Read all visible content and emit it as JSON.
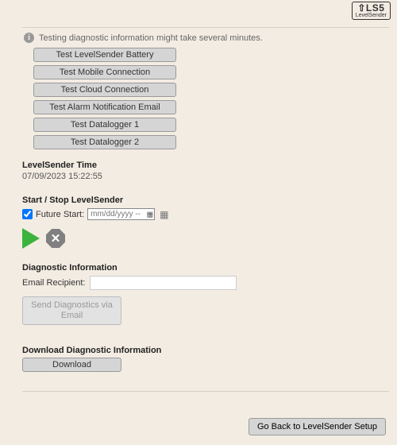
{
  "logo": {
    "top": "⇧LS5",
    "sub": "LevelSender"
  },
  "note": "Testing diagnostic information might take several minutes.",
  "test_buttons": [
    "Test LevelSender Battery",
    "Test Mobile Connection",
    "Test Cloud Connection",
    "Test Alarm Notification Email",
    "Test Datalogger 1",
    "Test Datalogger 2"
  ],
  "time": {
    "title": "LevelSender Time",
    "value": "07/09/2023 15:22:55"
  },
  "startstop": {
    "title": "Start / Stop LevelSender",
    "future_label": "Future Start:",
    "date_placeholder": "mm/dd/yyyy --"
  },
  "diag": {
    "title": "Diagnostic Information",
    "email_label": "Email Recipient:",
    "email_value": "",
    "send_button": "Send Diagnostics via Email"
  },
  "download": {
    "title": "Download Diagnostic Information",
    "button": "Download"
  },
  "back_button": "Go Back to LevelSender Setup"
}
